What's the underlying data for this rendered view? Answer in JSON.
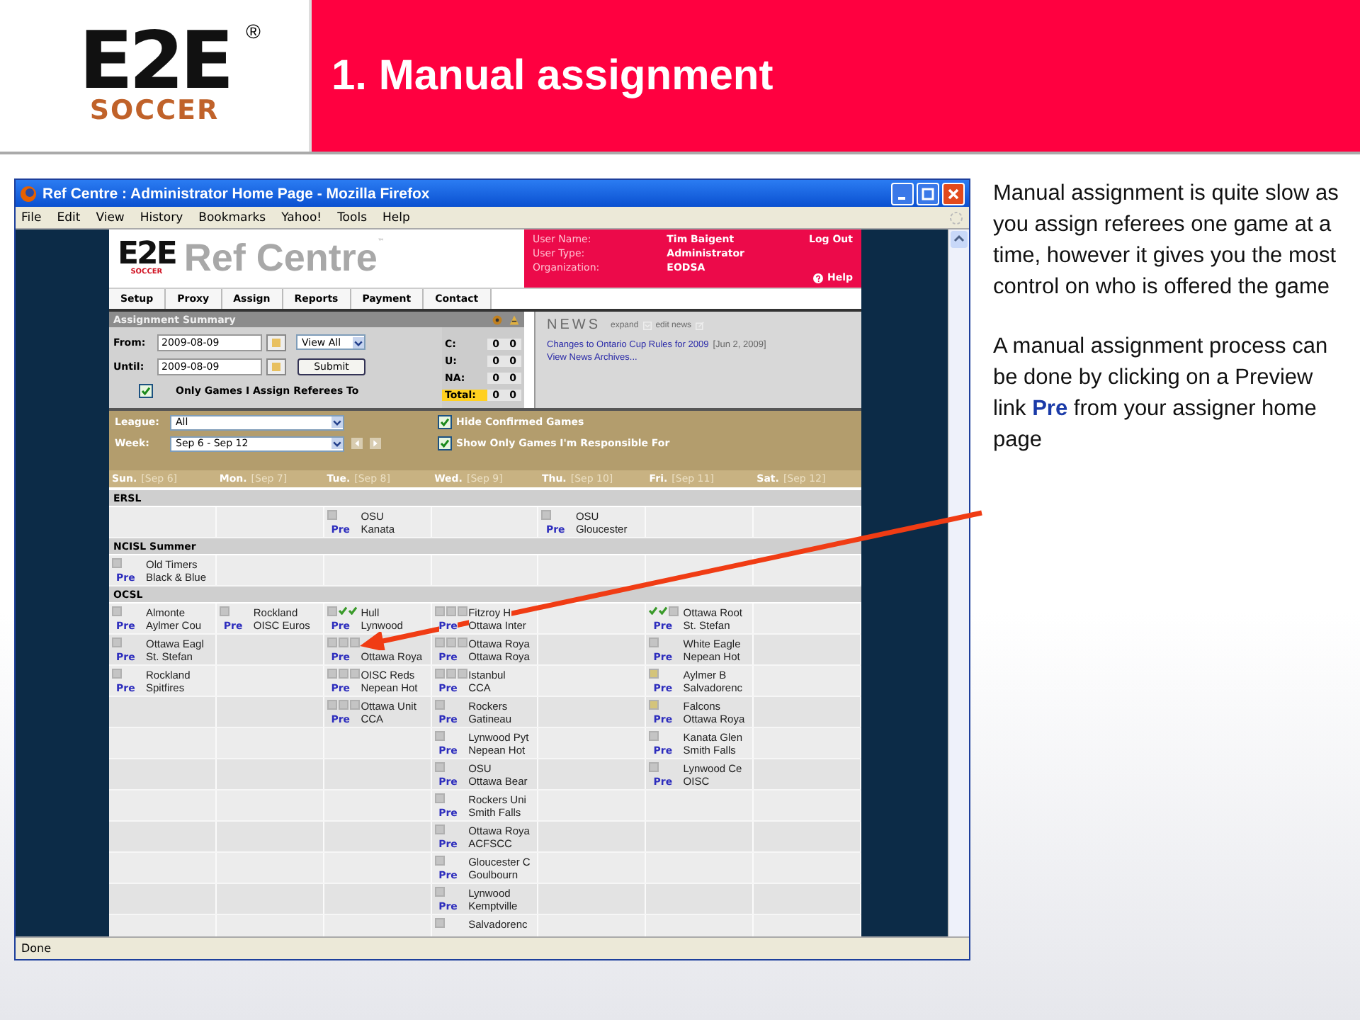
{
  "slide": {
    "logo": {
      "mark": "E2E",
      "sub": "SOCCER",
      "registered": "®"
    },
    "title": "1. Manual assignment",
    "paragraphs": [
      "Manual assignment is quite slow as you assign referees one game at a time, however it gives you the most control on who is offered the game",
      "A manual assignment process can be done by clicking on a Preview link **Pre** from your assigner home page"
    ]
  },
  "window": {
    "title": "Ref Centre : Administrator Home Page - Mozilla Firefox",
    "menu": [
      "File",
      "Edit",
      "View",
      "History",
      "Bookmarks",
      "Yahoo!",
      "Tools",
      "Help"
    ],
    "status": "Done"
  },
  "site": {
    "logo": {
      "mark": "E2E",
      "sub": "SOCCER"
    },
    "name": "Ref Centre",
    "trademark": "™",
    "user": [
      {
        "label": "User Name:",
        "value": "Tim Baigent"
      },
      {
        "label": "User Type:",
        "value": "Administrator"
      },
      {
        "label": "Organization:",
        "value": "EODSA"
      }
    ],
    "logout": "Log Out",
    "help": "Help",
    "tabs": [
      "Setup",
      "Proxy",
      "Assign",
      "Reports",
      "Payment",
      "Contact"
    ]
  },
  "summary": {
    "title": "Assignment Summary",
    "from_label": "From:",
    "from": "2009-08-09",
    "until_label": "Until:",
    "until": "2009-08-09",
    "view": "View All",
    "submit": "Submit",
    "only_mine": {
      "label": "Only Games I Assign Referees To",
      "checked": true
    },
    "counts": [
      {
        "label": "C:",
        "values": [
          "0",
          "0"
        ],
        "highlighted": false
      },
      {
        "label": "U:",
        "values": [
          "0",
          "0"
        ],
        "highlighted": false
      },
      {
        "label": "NA:",
        "values": [
          "0",
          "0"
        ],
        "highlighted": false
      },
      {
        "label": "Total:",
        "values": [
          "0",
          "0"
        ],
        "highlighted": true
      }
    ]
  },
  "news": {
    "title": "NEWS",
    "expand": "expand",
    "edit": "edit news",
    "items": [
      {
        "link": "Changes to Ontario Cup Rules for 2009",
        "date": "[Jun 2, 2009]"
      }
    ],
    "archive": "View News Archives..."
  },
  "filters": {
    "league_label": "League:",
    "league": "All",
    "week_label": "Week:",
    "week": "Sep 6 - Sep 12",
    "hide_confirmed": {
      "label": "Hide Confirmed Games",
      "checked": true
    },
    "responsible": {
      "label": "Show Only Games I'm Responsible For",
      "checked": true
    }
  },
  "days": [
    {
      "name": "Sun.",
      "date": "[Sep 6]"
    },
    {
      "name": "Mon.",
      "date": "[Sep 7]"
    },
    {
      "name": "Tue.",
      "date": "[Sep 8]"
    },
    {
      "name": "Wed.",
      "date": "[Sep 9]"
    },
    {
      "name": "Thu.",
      "date": "[Sep 10]"
    },
    {
      "name": "Fri.",
      "date": "[Sep 11]"
    },
    {
      "name": "Sat.",
      "date": "[Sep 12]"
    }
  ],
  "sections": [
    {
      "name": "ERSL",
      "rows": [
        [
          null,
          null,
          {
            "home": "OSU",
            "away": "Kanata",
            "link": "Pre",
            "marks": [
              {
                "kind": "box"
              }
            ]
          },
          null,
          {
            "home": "OSU",
            "away": "Gloucester",
            "link": "Pre",
            "marks": [
              {
                "kind": "box"
              }
            ]
          },
          null,
          null
        ]
      ]
    },
    {
      "name": "NCISL Summer",
      "rows": [
        [
          {
            "home": "Old Timers",
            "away": "Black & Blue",
            "link": "Pre",
            "marks": [
              {
                "kind": "box"
              }
            ]
          },
          null,
          null,
          null,
          null,
          null,
          null
        ]
      ]
    },
    {
      "name": "OCSL",
      "rows": [
        [
          {
            "home": "Almonte",
            "away": "Aylmer Cou",
            "link": "Pre",
            "marks": [
              {
                "kind": "box"
              }
            ]
          },
          {
            "home": "Rockland",
            "away": "OISC Euros",
            "link": "Pre",
            "marks": [
              {
                "kind": "box"
              }
            ]
          },
          {
            "home": "Hull",
            "away": "Lynwood",
            "link": "Pre",
            "marks": [
              {
                "kind": "box"
              },
              {
                "kind": "check"
              },
              {
                "kind": "check"
              }
            ]
          },
          {
            "home": "Fitzroy H",
            "away": "Ottawa Inter",
            "link": "Pre",
            "marks": [
              {
                "kind": "box"
              },
              {
                "kind": "box"
              },
              {
                "kind": "box"
              }
            ]
          },
          null,
          {
            "home": "Ottawa Root",
            "away": "St. Stefan",
            "link": "Pre",
            "marks": [
              {
                "kind": "check"
              },
              {
                "kind": "check"
              },
              {
                "kind": "box"
              }
            ]
          },
          null
        ],
        [
          {
            "home": "Ottawa Eagl",
            "away": "St. Stefan",
            "link": "Pre",
            "marks": [
              {
                "kind": "box"
              }
            ]
          },
          null,
          {
            "away": "Ottawa Roya",
            "link": "Pre",
            "marks": [
              {
                "kind": "box"
              },
              {
                "kind": "box"
              },
              {
                "kind": "box"
              }
            ]
          },
          {
            "home": "Ottawa Roya",
            "away": "Ottawa Roya",
            "link": "Pre",
            "marks": [
              {
                "kind": "box"
              },
              {
                "kind": "box"
              },
              {
                "kind": "box"
              }
            ]
          },
          null,
          {
            "home": "White Eagle",
            "away": "Nepean Hot",
            "link": "Pre",
            "marks": [
              {
                "kind": "box"
              }
            ]
          },
          null
        ],
        [
          {
            "home": "Rockland",
            "away": "Spitfires",
            "link": "Pre",
            "marks": [
              {
                "kind": "box"
              }
            ]
          },
          null,
          {
            "home": "OISC Reds",
            "away": "Nepean Hot",
            "link": "Pre",
            "marks": [
              {
                "kind": "box"
              },
              {
                "kind": "box"
              },
              {
                "kind": "box"
              }
            ]
          },
          {
            "home": "Istanbul",
            "away": "CCA",
            "link": "Pre",
            "marks": [
              {
                "kind": "box"
              },
              {
                "kind": "box"
              },
              {
                "kind": "box"
              }
            ]
          },
          null,
          {
            "home": "Aylmer B",
            "away": "Salvadorenc",
            "link": "Pre",
            "marks": [
              {
                "kind": "pending"
              }
            ]
          },
          null
        ],
        [
          null,
          null,
          {
            "home": "Ottawa Unit",
            "away": "CCA",
            "link": "Pre",
            "marks": [
              {
                "kind": "box"
              },
              {
                "kind": "box"
              },
              {
                "kind": "box"
              }
            ]
          },
          {
            "home": "Rockers",
            "away": "Gatineau",
            "link": "Pre",
            "marks": [
              {
                "kind": "box"
              }
            ]
          },
          null,
          {
            "home": "Falcons",
            "away": "Ottawa Roya",
            "link": "Pre",
            "marks": [
              {
                "kind": "pending"
              }
            ]
          },
          null
        ],
        [
          null,
          null,
          null,
          {
            "home": "Lynwood Pyt",
            "away": "Nepean Hot",
            "link": "Pre",
            "marks": [
              {
                "kind": "box"
              }
            ]
          },
          null,
          {
            "home": "Kanata Glen",
            "away": "Smith Falls",
            "link": "Pre",
            "marks": [
              {
                "kind": "box"
              }
            ]
          },
          null
        ],
        [
          null,
          null,
          null,
          {
            "home": "OSU",
            "away": "Ottawa Bear",
            "link": "Pre",
            "marks": [
              {
                "kind": "box"
              }
            ]
          },
          null,
          {
            "home": "Lynwood Ce",
            "away": "OISC",
            "link": "Pre",
            "marks": [
              {
                "kind": "box"
              }
            ]
          },
          null
        ],
        [
          null,
          null,
          null,
          {
            "home": "Rockers Uni",
            "away": "Smith Falls",
            "link": "Pre",
            "marks": [
              {
                "kind": "box"
              }
            ]
          },
          null,
          null,
          null
        ],
        [
          null,
          null,
          null,
          {
            "home": "Ottawa Roya",
            "away": "ACFSCC",
            "link": "Pre",
            "marks": [
              {
                "kind": "box"
              }
            ]
          },
          null,
          null,
          null
        ],
        [
          null,
          null,
          null,
          {
            "home": "Gloucester C",
            "away": "Goulbourn",
            "link": "Pre",
            "marks": [
              {
                "kind": "box"
              }
            ]
          },
          null,
          null,
          null
        ],
        [
          null,
          null,
          null,
          {
            "home": "Lynwood",
            "away": "Kemptville",
            "link": "Pre",
            "marks": [
              {
                "kind": "box"
              }
            ]
          },
          null,
          null,
          null
        ],
        [
          null,
          null,
          null,
          {
            "home": "Salvadorenc",
            "marks": [
              {
                "kind": "box"
              }
            ]
          },
          null,
          null,
          null
        ]
      ]
    }
  ]
}
